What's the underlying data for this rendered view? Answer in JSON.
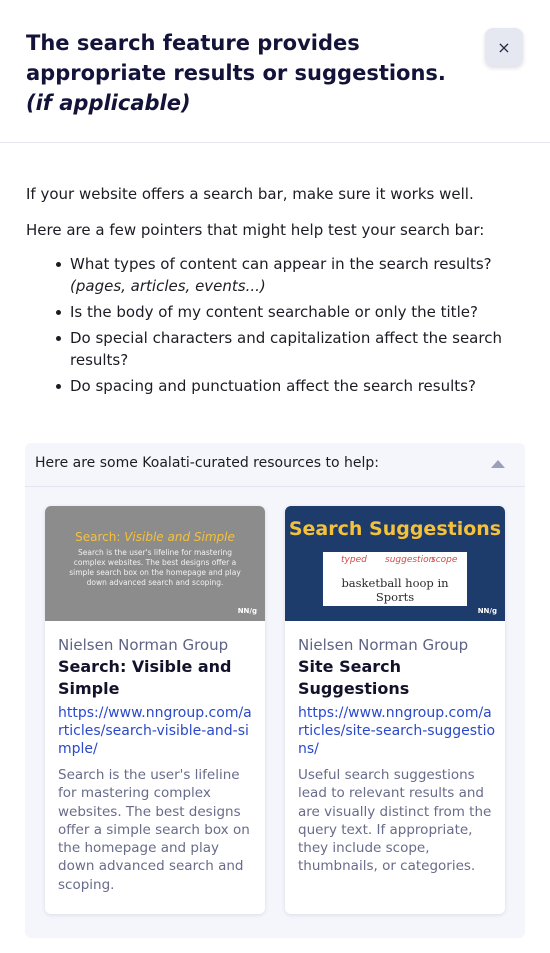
{
  "modal": {
    "title_main": "The search feature provides appropriate results or suggestions.",
    "title_note": "(if applicable)",
    "close_icon": "×"
  },
  "intro": {
    "p1": "If your website offers a search bar, make sure it works well.",
    "p2": "Here are a few pointers that might help test your search bar:"
  },
  "pointers": [
    {
      "text": "What types of content can appear in the search results?",
      "note": "(pages, articles, events...)"
    },
    {
      "text": "Is the body of my content searchable or only the title?"
    },
    {
      "text": "Do special characters and capitalization affect the search results?"
    },
    {
      "text": "Do spacing and punctuation affect the search results?"
    }
  ],
  "resources": {
    "header": "Here are some Koalati-curated resources to help:",
    "toggle_icon": "chevron-up-icon",
    "cards": [
      {
        "thumb_heading_a": "Search:",
        "thumb_heading_b": "Visible and Simple",
        "thumb_body": "Search is the user's lifeline for mastering complex websites. The best designs offer a simple search box on the homepage and play down advanced search and scoping.",
        "thumb_logo": "NN/g",
        "source": "Nielsen Norman Group",
        "title": "Search: Visible and Simple",
        "url": "https://www.nngroup.com/articles/search-visible-and-simple/",
        "description": "Search is the user's lifeline for mastering complex websites. The best designs offer a simple search box on the homepage and play down advanced search and scoping."
      },
      {
        "thumb_heading": "Search Suggestions",
        "thumb_sketch_words": [
          "typed",
          "suggestion",
          "scope"
        ],
        "thumb_sketch_main": "basketball hoop in Sports",
        "thumb_logo": "NN/g",
        "source": "Nielsen Norman Group",
        "title": "Site Search Suggestions",
        "url": "https://www.nngroup.com/articles/site-search-suggestions/",
        "description": "Useful search suggestions lead to relevant results and are visually distinct from the query text. If appropriate, they include scope, thumbnails, or categories."
      }
    ]
  },
  "colors": {
    "heading": "#13133a",
    "link": "#2a49c8",
    "muted": "#686c8a",
    "panel_bg": "#f5f6fc",
    "thumb_yellow": "#f3c13a"
  }
}
